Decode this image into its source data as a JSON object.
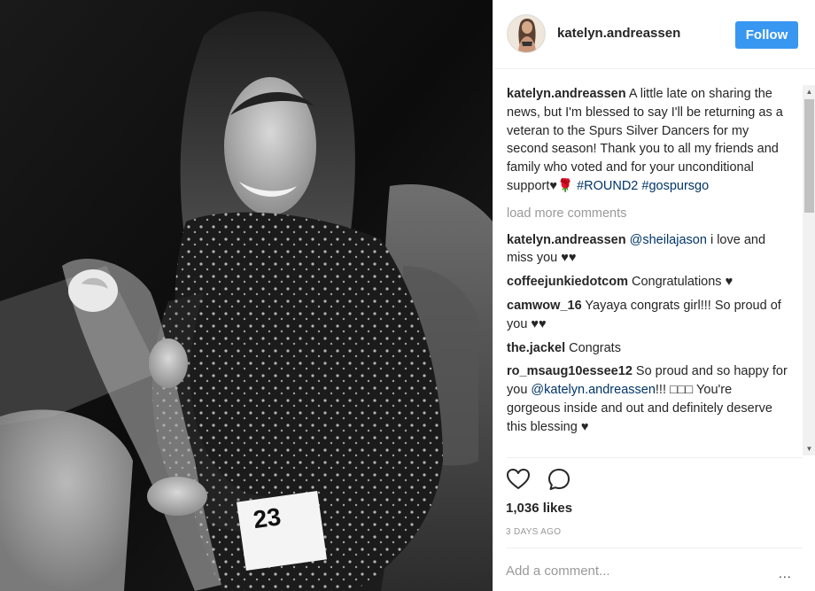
{
  "header": {
    "username": "katelyn.andreassen",
    "follow_label": "Follow"
  },
  "caption": {
    "username": "katelyn.andreassen",
    "text": " A little late on sharing the news, but I'm blessed to say I'll be returning as a veteran to the Spurs Silver Dancers for my second season! Thank you to all my friends and family who voted and for your unconditional support♥🌹 ",
    "hashtags": "#ROUND2 #gospursgo"
  },
  "load_more": "load more comments",
  "comments": [
    {
      "username": "katelyn.andreassen",
      "mention": "@sheilajason",
      "text": " i love and miss you ♥♥"
    },
    {
      "username": "coffeejunkiedotcom",
      "text": " Congratulations ♥"
    },
    {
      "username": "camwow_16",
      "text": " Yayaya congrats girl!!! So proud of you ♥♥"
    },
    {
      "username": "the.jackel",
      "text": " Congrats"
    },
    {
      "username": "ro_msaug10essee12",
      "text": " So proud and so happy for you ",
      "mention": "@katelyn.andreassen",
      "text2": "!!! □□□ You're gorgeous inside and out and definitely deserve this blessing ♥"
    }
  ],
  "likes": "1,036 likes",
  "timestamp": "3 DAYS AGO",
  "add_comment_placeholder": "Add a comment...",
  "more_options": "...",
  "colors": {
    "follow_button": "#3897f0",
    "link": "#003569",
    "muted": "#999999"
  },
  "icons": {
    "like": "heart-outline-icon",
    "comment": "speech-bubble-icon"
  }
}
